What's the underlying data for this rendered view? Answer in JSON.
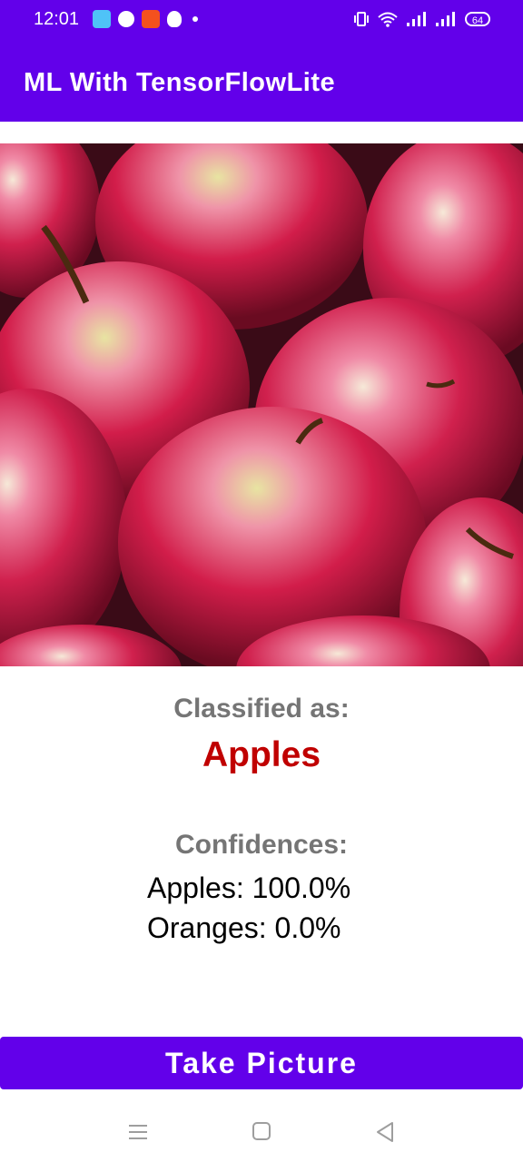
{
  "status_bar": {
    "time": "12:01",
    "battery": "64",
    "notification_icons": [
      "app-icon",
      "facebook-icon",
      "app-icon",
      "snapchat-icon",
      "dot-icon"
    ],
    "system_icons": [
      "vibrate-icon",
      "wifi-icon",
      "signal-icon",
      "signal-icon",
      "battery-icon"
    ]
  },
  "app_bar": {
    "title": "ML With TensorFlowLite"
  },
  "photo": {
    "subject": "apples"
  },
  "result": {
    "classified_label": "Classified as:",
    "classified_value": "Apples",
    "confidences_label": "Confidences:",
    "confidences": [
      {
        "text": "Apples: 100.0%"
      },
      {
        "text": "Oranges: 0.0%"
      }
    ]
  },
  "actions": {
    "take_picture": "Take Picture"
  },
  "nav_bar": {
    "buttons": [
      "menu-icon",
      "home-icon",
      "back-icon"
    ]
  },
  "colors": {
    "primary": "#6200ea",
    "result": "#c00000",
    "label": "#757575"
  }
}
